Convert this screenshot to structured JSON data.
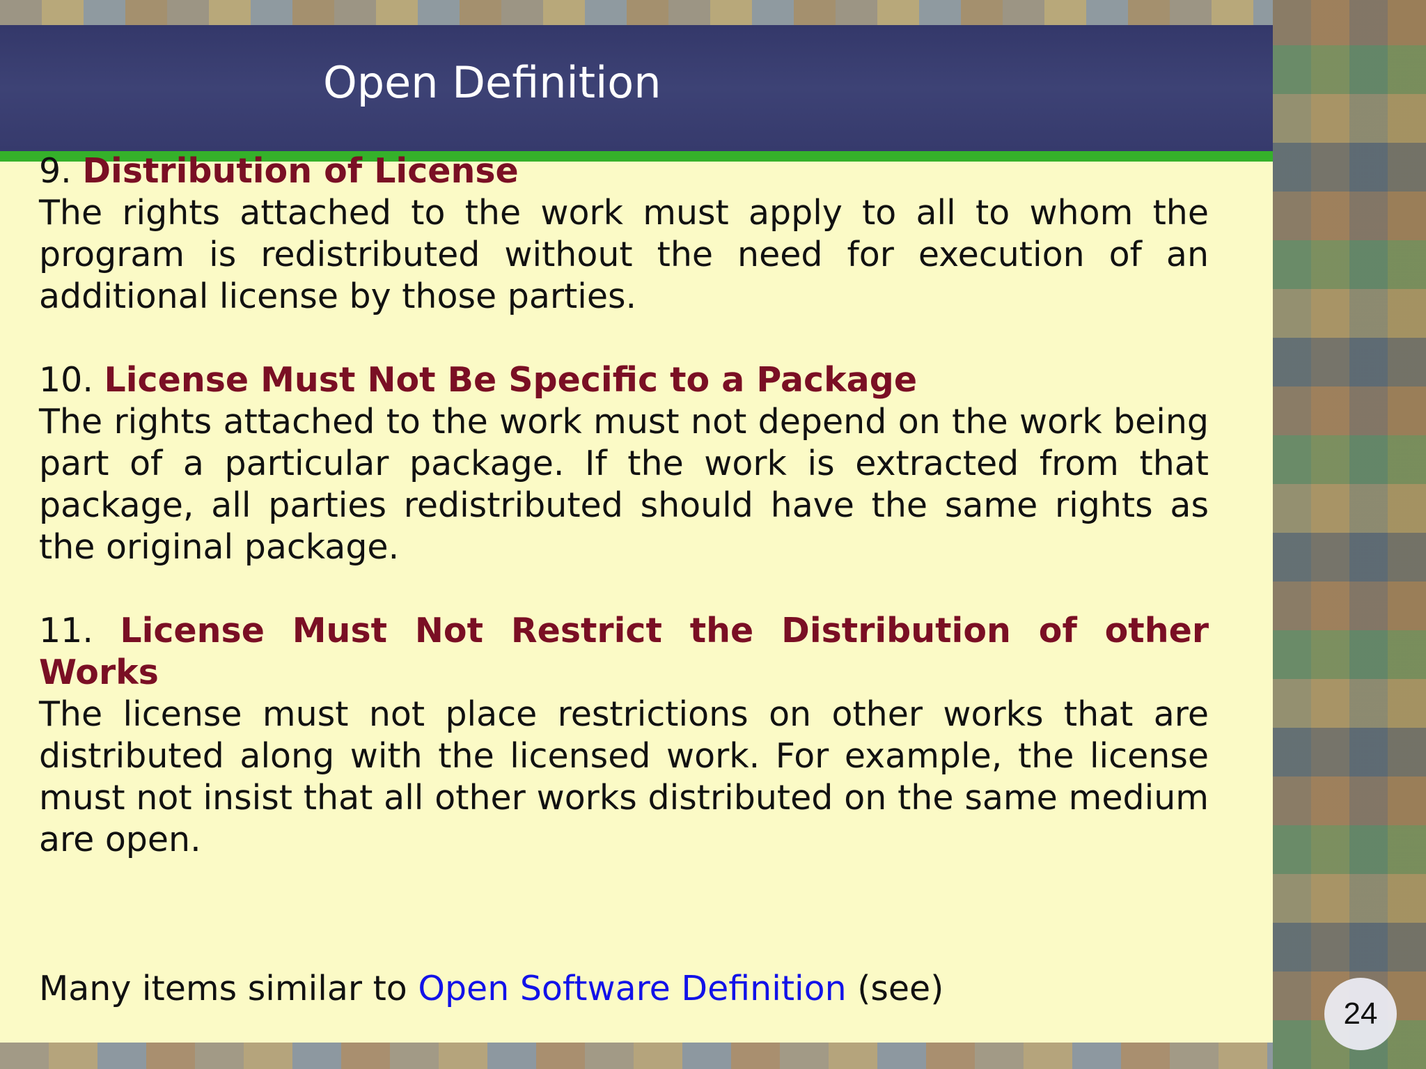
{
  "slide": {
    "title": "Open Definition",
    "page_number": "24",
    "sections": [
      {
        "number": "9.",
        "heading": "Distribution of License",
        "body": "The rights attached to the work must apply to all to whom the program is redistributed without the need for execution of an additional license by those parties."
      },
      {
        "number": "10.",
        "heading": "License Must Not Be Specific to a Package",
        "body": "The rights attached to the work must not depend on the work being part of a particular package. If the work is extracted from that package, all parties redistributed should have the same rights as the original package."
      },
      {
        "number": "11.",
        "heading": "License Must Not Restrict the Distribution of other Works",
        "body": "The license must not place restrictions on other works that are distributed along with the licensed work. For example, the license must not insist that all other works distributed on the same medium are open."
      }
    ],
    "footer": {
      "prefix": "Many items similar to",
      "link_text": "Open Software Definition",
      "suffix": "(see)"
    }
  }
}
